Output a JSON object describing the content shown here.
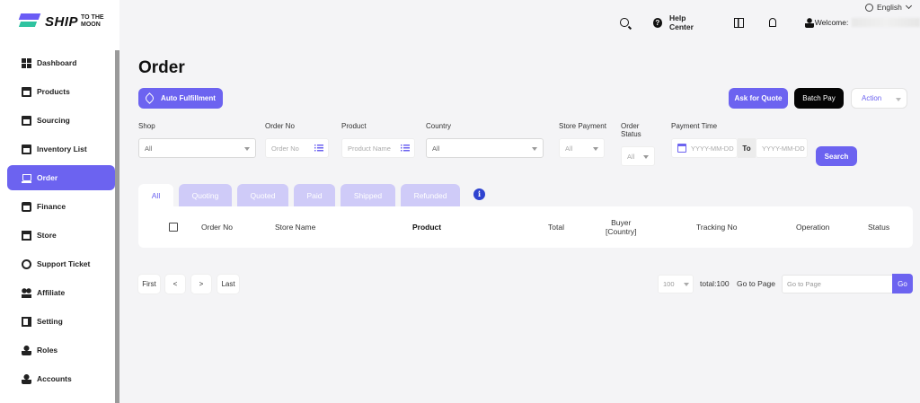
{
  "brand": {
    "name": "SHIP",
    "tagline_1": "TO THE",
    "tagline_2": "MOON"
  },
  "colors": {
    "accent": "#6c63f0",
    "tab_inactive": "#cfcbf8",
    "batch_pay": "#050505"
  },
  "sidebar": {
    "items": [
      {
        "label": "Dashboard",
        "icon": "dashboard-icon",
        "active": false
      },
      {
        "label": "Products",
        "icon": "box-icon",
        "active": false
      },
      {
        "label": "Sourcing",
        "icon": "sourcing-icon",
        "active": false
      },
      {
        "label": "Inventory List",
        "icon": "inventory-icon",
        "active": false
      },
      {
        "label": "Order",
        "icon": "cart-icon",
        "active": true
      },
      {
        "label": "Finance",
        "icon": "card-icon",
        "active": false
      },
      {
        "label": "Store",
        "icon": "store-icon",
        "active": false
      },
      {
        "label": "Support Ticket",
        "icon": "chat-icon",
        "active": false
      },
      {
        "label": "Affiliate",
        "icon": "people-icon",
        "active": false
      },
      {
        "label": "Setting",
        "icon": "truck-icon",
        "active": false
      },
      {
        "label": "Roles",
        "icon": "person-icon",
        "active": false
      },
      {
        "label": "Accounts",
        "icon": "person-icon",
        "active": false
      }
    ]
  },
  "topbar": {
    "language": "English",
    "help": "Help Center",
    "welcome": "Welcome:"
  },
  "page": {
    "title": "Order"
  },
  "actions": {
    "auto_fulfillment": "Auto Fulfillment",
    "ask_for_quote": "Ask for Quote",
    "batch_pay": "Batch Pay",
    "action": "Action"
  },
  "filters": {
    "shop": {
      "label": "Shop",
      "value": "All"
    },
    "order_no": {
      "label": "Order No",
      "placeholder": "Order No"
    },
    "product": {
      "label": "Product",
      "placeholder": "Product Name"
    },
    "country": {
      "label": "Country",
      "value": "All"
    },
    "store_payment": {
      "label": "Store Payment",
      "value": "All"
    },
    "order_status": {
      "label_1": "Order",
      "label_2": "Status",
      "value": "All"
    },
    "payment_time": {
      "label": "Payment Time",
      "from_placeholder": "YYYY-MM-DD",
      "to_label": "To",
      "to_placeholder": "YYYY-MM-DD"
    },
    "search": "Search"
  },
  "tabs": [
    "All",
    "Quoting",
    "Quoted",
    "Paid",
    "Shipped",
    "Refunded"
  ],
  "table": {
    "columns": {
      "order_no": "Order No",
      "store_name": "Store Name",
      "product": "Product",
      "total": "Total",
      "buyer_1": "Buyer",
      "buyer_2": "[Country]",
      "tracking": "Tracking No",
      "operation": "Operation",
      "status": "Status"
    }
  },
  "pagination": {
    "first": "First",
    "prev": "<",
    "next": ">",
    "last": "Last",
    "page_size": "100",
    "total": "total:100",
    "go_to_page": "Go to Page",
    "go_placeholder": "Go to Page",
    "go": "Go"
  }
}
